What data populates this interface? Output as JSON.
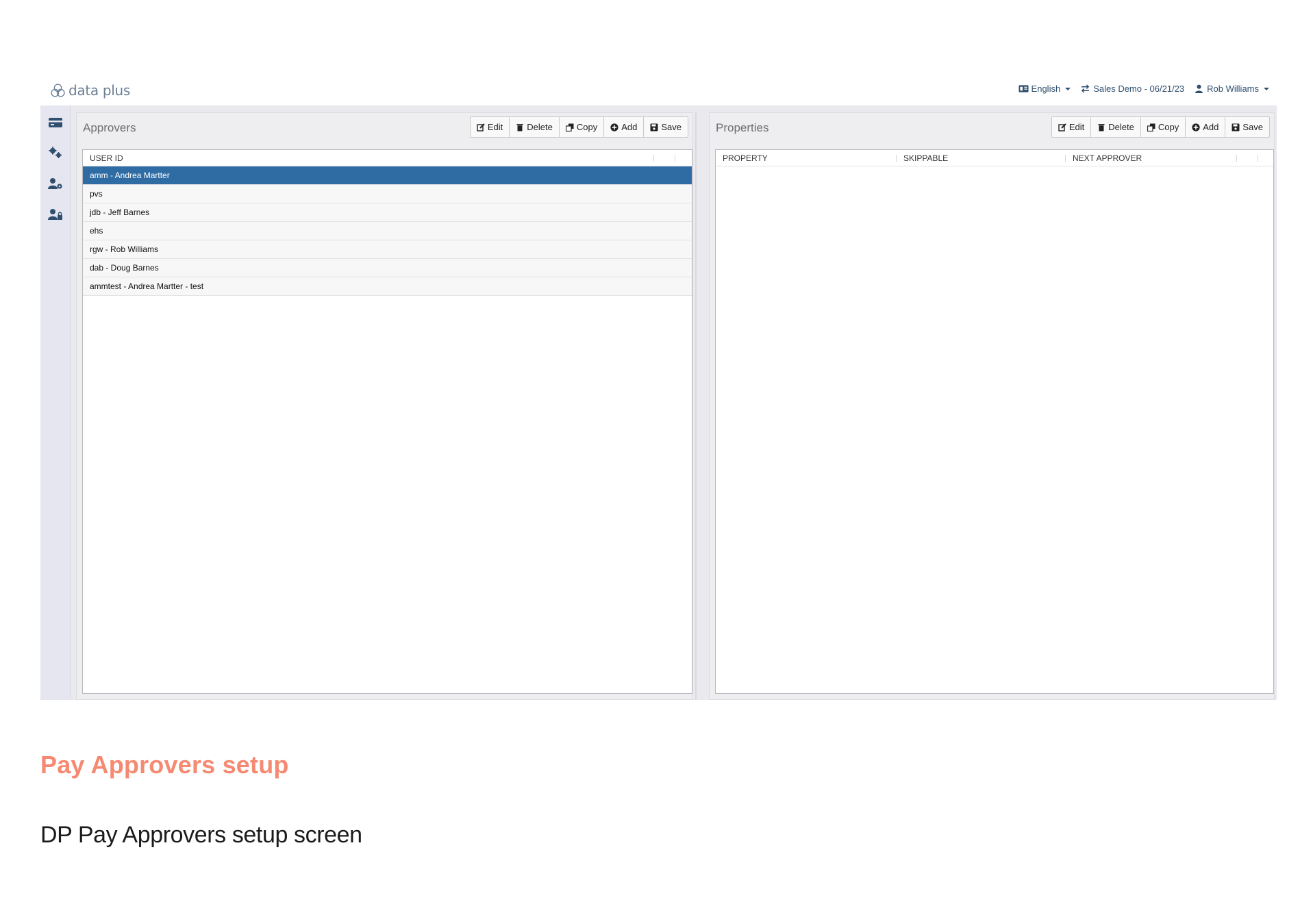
{
  "header": {
    "logo_text": "data plus",
    "language": "English",
    "environment": "Sales Demo - 06/21/23",
    "user": "Rob Williams"
  },
  "sidebar": {
    "items": [
      {
        "icon": "card-icon"
      },
      {
        "icon": "gears-icon"
      },
      {
        "icon": "user-gear-icon"
      },
      {
        "icon": "user-lock-icon"
      }
    ]
  },
  "approvers_panel": {
    "title": "Approvers",
    "toolbar": {
      "edit": "Edit",
      "delete": "Delete",
      "copy": "Copy",
      "add": "Add",
      "save": "Save"
    },
    "columns": [
      "USER ID"
    ],
    "rows": [
      "amm - Andrea Martter",
      "pvs",
      "jdb - Jeff Barnes",
      "ehs",
      "rgw - Rob Williams",
      "dab - Doug Barnes",
      "ammtest - Andrea Martter - test"
    ],
    "selected_index": 0
  },
  "properties_panel": {
    "title": "Properties",
    "toolbar": {
      "edit": "Edit",
      "delete": "Delete",
      "copy": "Copy",
      "add": "Add",
      "save": "Save"
    },
    "columns": [
      "PROPERTY",
      "SKIPPABLE",
      "NEXT APPROVER"
    ]
  },
  "caption": {
    "title": "Pay Approvers setup",
    "subtitle": "DP Pay Approvers setup screen"
  },
  "colors": {
    "selected_row": "#2f6ca4",
    "caption_title": "#f58971",
    "nav_text": "#2f4f6f"
  }
}
